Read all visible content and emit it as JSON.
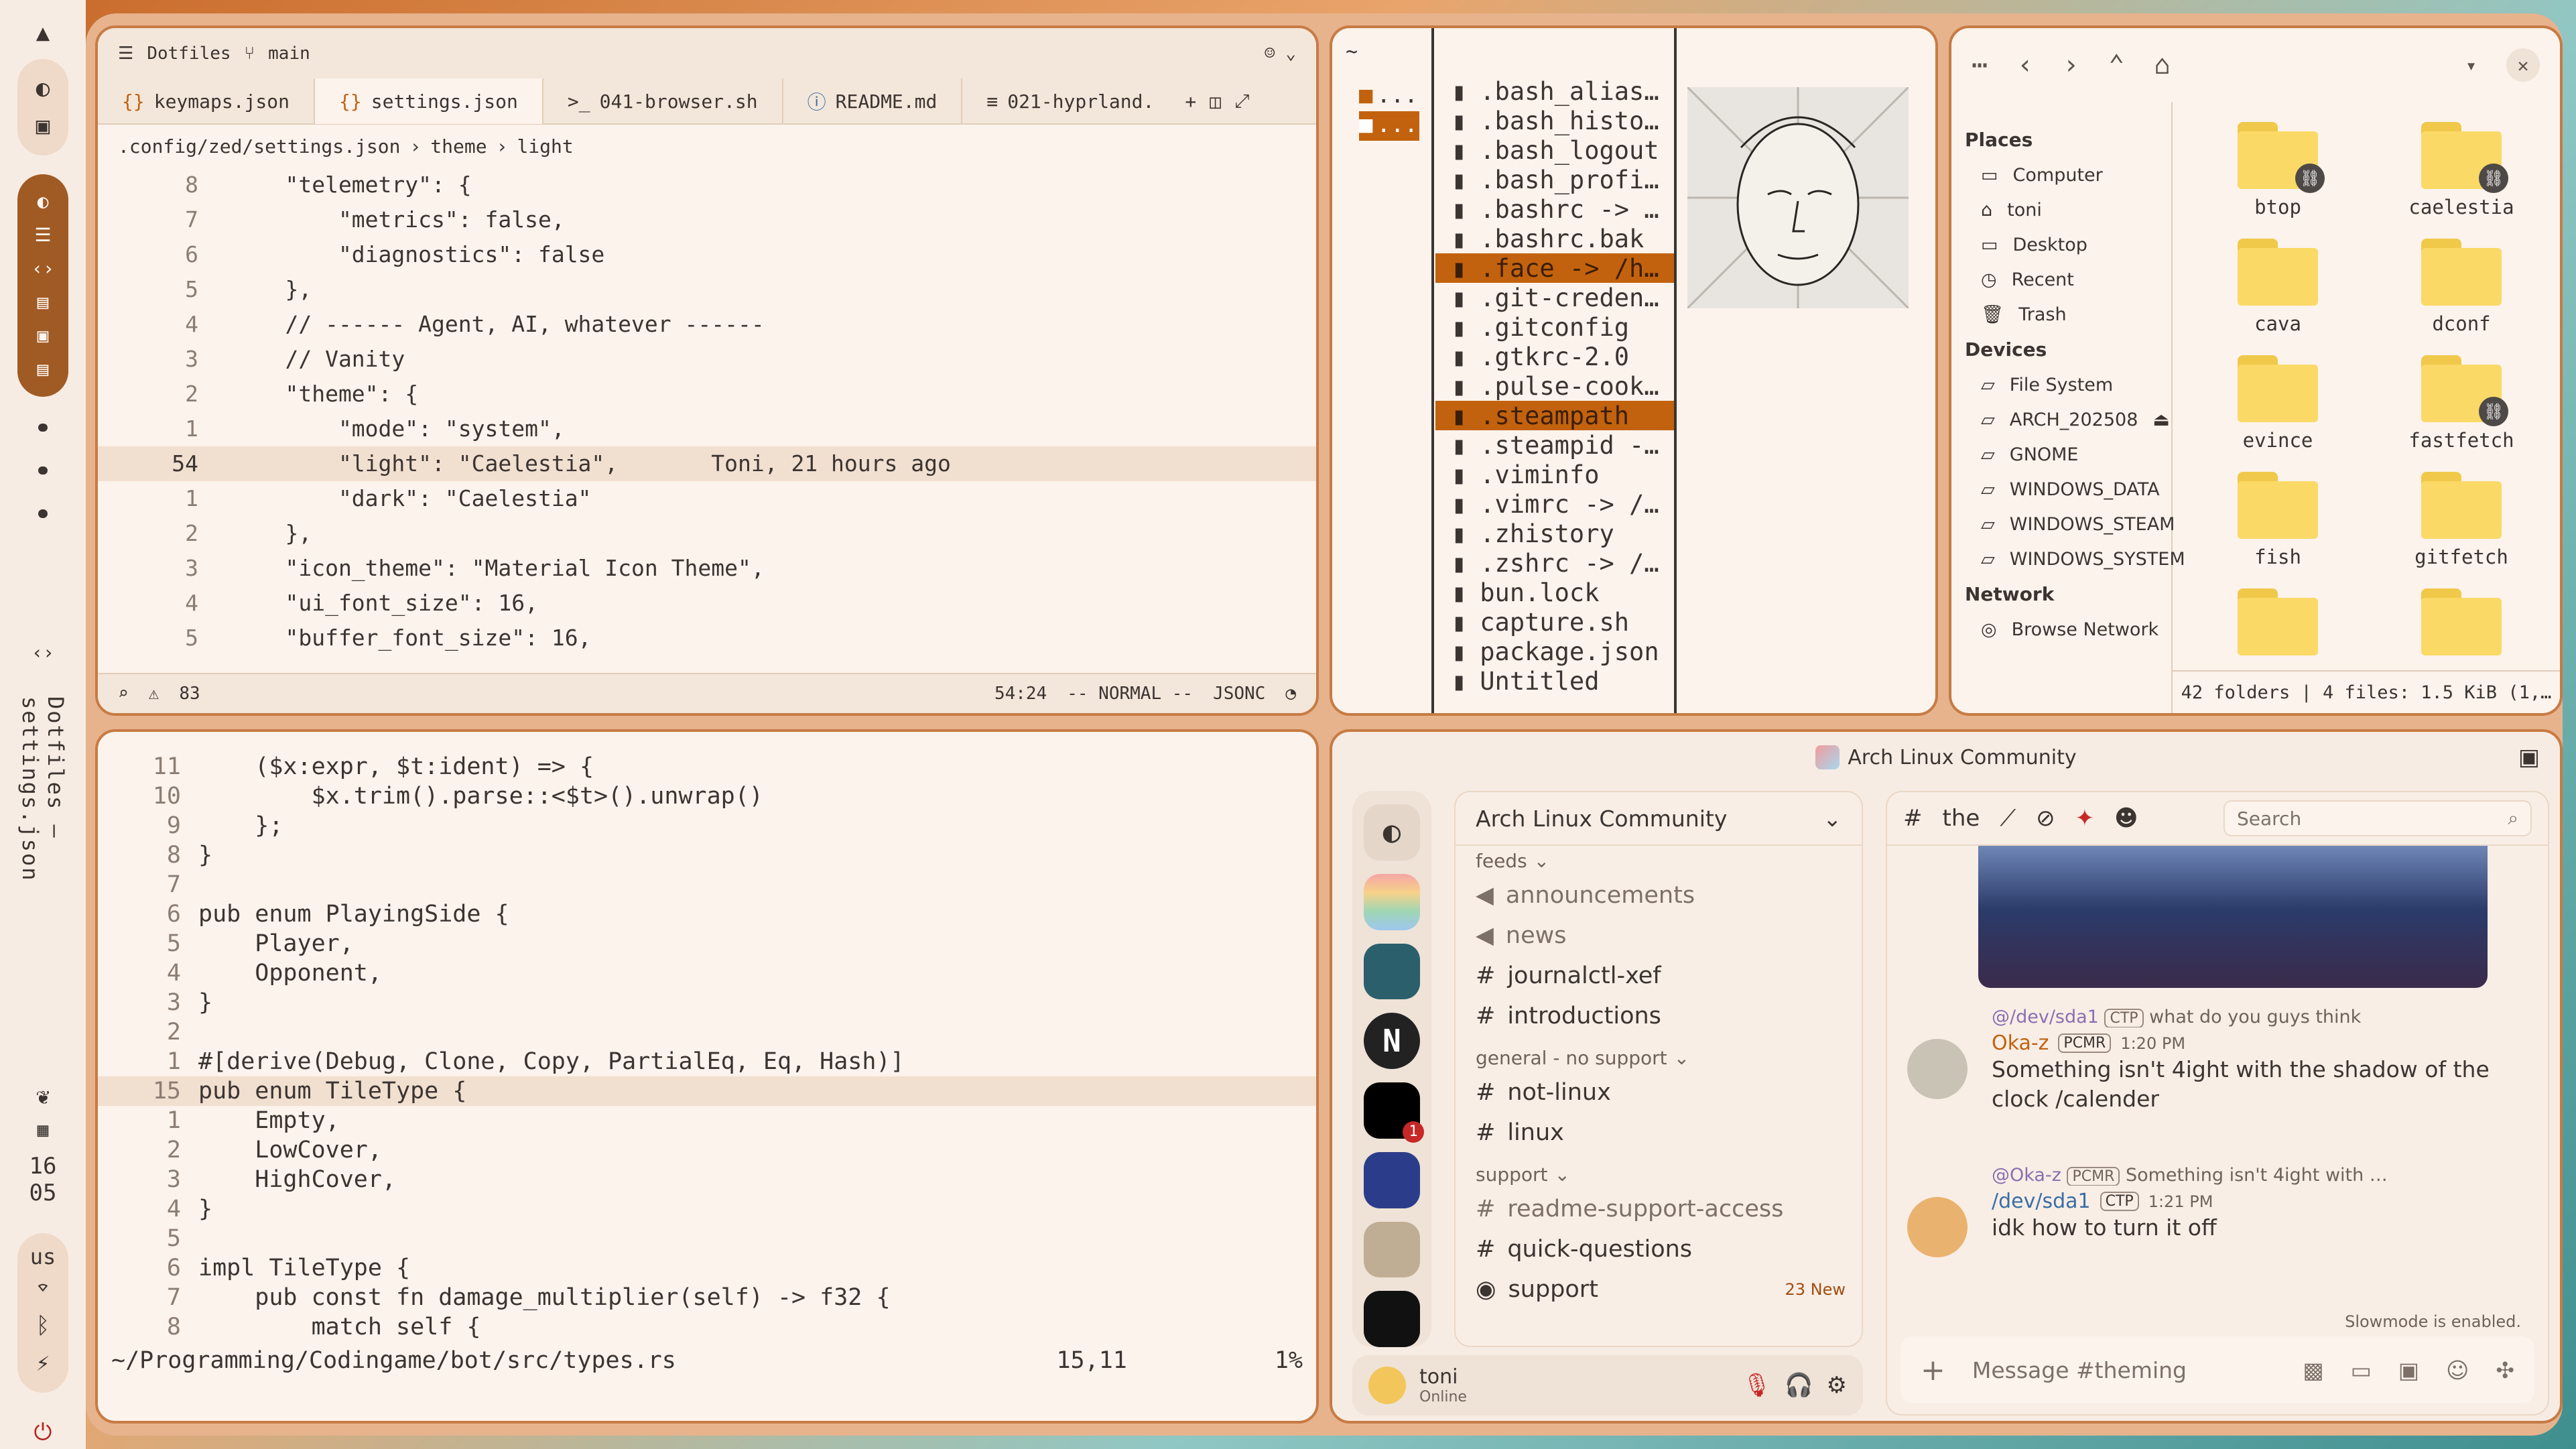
{
  "sidebar": {
    "vertical_title": "Dotfiles – settings.json",
    "clock_hour": "16",
    "clock_min": "05",
    "lang": "us"
  },
  "zed": {
    "project": "Dotfiles",
    "branch": "main",
    "tabs": [
      "keymaps.json",
      "settings.json",
      "041-browser.sh",
      "README.md",
      "021-hyprland."
    ],
    "crumb": [
      ".config/zed/settings.json",
      "theme",
      "light"
    ],
    "lines": [
      {
        "n": "8",
        "t": "    \"telemetry\": {"
      },
      {
        "n": "7",
        "t": "        \"metrics\": false,"
      },
      {
        "n": "6",
        "t": "        \"diagnostics\": false"
      },
      {
        "n": "5",
        "t": "    },"
      },
      {
        "n": "4",
        "t": "    // ------ Agent, AI, whatever ------"
      },
      {
        "n": "3",
        "t": "    // Vanity"
      },
      {
        "n": "2",
        "t": "    \"theme\": {"
      },
      {
        "n": "1",
        "t": "        \"mode\": \"system\","
      },
      {
        "n": "54",
        "t": "        \"light\": \"Caelestia\",       Toni, 21 hours ago"
      },
      {
        "n": "1",
        "t": "        \"dark\": \"Caelestia\""
      },
      {
        "n": "2",
        "t": "    },"
      },
      {
        "n": "3",
        "t": "    \"icon_theme\": \"Material Icon Theme\","
      },
      {
        "n": "4",
        "t": "    \"ui_font_size\": 16,"
      },
      {
        "n": "5",
        "t": "    \"buffer_font_size\": 16,"
      }
    ],
    "status": {
      "warnings": "83",
      "pos": "54:24",
      "mode": "-- NORMAL --",
      "lang": "JSONC"
    }
  },
  "term": {
    "lines": [
      {
        "n": "11",
        "t": "    ($x:expr, $t:ident) => {"
      },
      {
        "n": "10",
        "t": "        $x.trim().parse::<$t>().unwrap()"
      },
      {
        "n": "9",
        "t": "    };"
      },
      {
        "n": "8",
        "t": "}"
      },
      {
        "n": "7",
        "t": ""
      },
      {
        "n": "6",
        "t": "pub enum PlayingSide {"
      },
      {
        "n": "5",
        "t": "    Player,"
      },
      {
        "n": "4",
        "t": "    Opponent,"
      },
      {
        "n": "3",
        "t": "}"
      },
      {
        "n": "2",
        "t": ""
      },
      {
        "n": "1",
        "t": "#[derive(Debug, Clone, Copy, PartialEq, Eq, Hash)]"
      },
      {
        "n": "15",
        "t": "pub enum TileType {"
      },
      {
        "n": "1",
        "t": "    Empty,"
      },
      {
        "n": "2",
        "t": "    LowCover,"
      },
      {
        "n": "3",
        "t": "    HighCover,"
      },
      {
        "n": "4",
        "t": "}"
      },
      {
        "n": "5",
        "t": ""
      },
      {
        "n": "6",
        "t": "impl TileType {"
      },
      {
        "n": "7",
        "t": "    pub const fn damage_multiplier(self) -> f32 {"
      },
      {
        "n": "8",
        "t": "        match self {"
      }
    ],
    "path": "~/Programming/Codingame/bot/src/types.rs",
    "pos": "15,11",
    "pct": "1%"
  },
  "lf": {
    "path": "~",
    "dirs": [
      "...",
      "..."
    ],
    "files": [
      ".bash_alias…",
      ".bash_histo…",
      ".bash_logout",
      ".bash_profi…",
      ".bashrc -> …",
      ".bashrc.bak",
      ".face -> /h…",
      ".git-creden…",
      ".gitconfig",
      ".gtkrc-2.0",
      ".pulse-cook…",
      ".steampath",
      ".steampid -…",
      ".viminfo",
      ".vimrc -> /…",
      ".zhistory",
      ".zshrc -> /…",
      "bun.lock",
      "capture.sh",
      "package.json",
      "Untitled"
    ]
  },
  "nautilus": {
    "places_h": "Places",
    "places": [
      "Computer",
      "toni",
      "Desktop",
      "Recent",
      "Trash"
    ],
    "devices_h": "Devices",
    "devices": [
      "File System",
      "ARCH_202508",
      "GNOME",
      "WINDOWS_DATA",
      "WINDOWS_STEAM",
      "WINDOWS_SYSTEM"
    ],
    "network_h": "Network",
    "network": [
      "Browse Network"
    ],
    "folders": [
      "btop",
      "caelestia",
      "cava",
      "dconf",
      "evince",
      "fastfetch",
      "fish",
      "gitfetch",
      "",
      ""
    ],
    "footer": "42 folders  |  4 files: 1.5 KiB (1,…"
  },
  "discord": {
    "title": "Arch Linux Community",
    "server": "Arch Linux Community",
    "cat_feeds": "feeds",
    "ch_announcements": "announcements",
    "ch_news": "news",
    "ch_journal": "journalctl-xef",
    "ch_intro": "introductions",
    "cat_general": "general - no support",
    "ch_notlinux": "not-linux",
    "ch_linux": "linux",
    "cat_support": "support",
    "ch_readme": "readme-support-access",
    "ch_quick": "quick-questions",
    "ch_support": "support",
    "support_new": "23 New",
    "user": "toni",
    "user_status": "Online",
    "chat_channel": "the",
    "search_placeholder": "Search",
    "m1_reply_user": "@/dev/sda1",
    "m1_reply_badge": "CTP",
    "m1_reply_text": "what do you guys think",
    "m1_user": "Oka-z",
    "m1_badge": "PCMR",
    "m1_time": "1:20 PM",
    "m1_text": "Something isn't 4ight with the shadow of the clock /calender",
    "m2_reply_user": "@Oka-z",
    "m2_reply_badge": "PCMR",
    "m2_reply_text": "Something isn't 4ight with …",
    "m2_user": "/dev/sda1",
    "m2_badge": "CTP",
    "m2_time": "1:21 PM",
    "m2_text": "idk how to turn it off",
    "slowmode": "Slowmode is enabled.",
    "compose_placeholder": "Message #theming",
    "badge_count": "1"
  }
}
